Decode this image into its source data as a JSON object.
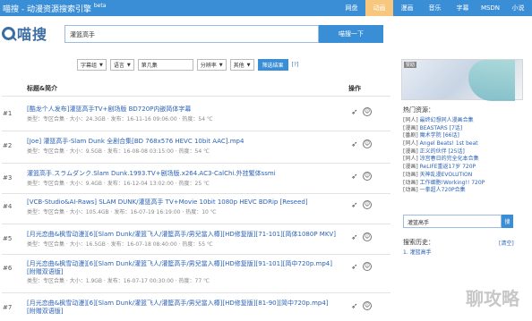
{
  "header": {
    "site_title": "喵搜 - 动漫资源搜索引擎",
    "beta": "beta",
    "nav": [
      "网盘",
      "动画",
      "漫画",
      "音乐",
      "字幕",
      "MSDN",
      "小说"
    ],
    "active_nav": "动画"
  },
  "logo": {
    "text": "喵搜"
  },
  "search": {
    "value": "灌篮高手",
    "button": "喵搜一下"
  },
  "filters": {
    "items": [
      "字幕组",
      "语言",
      "第几集",
      "分辨率",
      "其他"
    ],
    "button": "筛选结果",
    "help": "[?]"
  },
  "table": {
    "col_title": "标题&简介",
    "col_action": "操作"
  },
  "results": [
    {
      "num": "#1",
      "title": "[酷龙个人发布]灌篮高手TV+剧场版 BD720P内嵌简体字幕",
      "meta": "类型：专区合集 · 大小：24.3GB · 发布：16-11-16 09:06:00 · 热度：54 ℃"
    },
    {
      "num": "#2",
      "title": "[Joe] 灌篮高手-Slam Dunk 全剧合集[BD 768x576 HEVC 10bit AAC].mp4",
      "meta": "类型：专区合集 · 大小：9.5GB · 发布：16-08-08 03:15:00 · 热度：54 ℃"
    },
    {
      "num": "#3",
      "title": "灌篮高手.スラムダンク.Slam Dunk.1993.TV+剧场版.x264.AC3-CalChi.外挂繁体ssmi",
      "meta": "类型：专区合集 · 大小：9.4GB · 发布：16-12-04 13:02:00 · 热度：25 ℃"
    },
    {
      "num": "#4",
      "title": "[VCB-Studio&AI-Raws] SLAM DUNK/灌篮高手 TV+Movie 10bit 1080p HEVC BDRip [Reseed]",
      "meta": "类型：专区合集 · 大小：105.4GB · 发布：16-07-19 16:19:00 · 热度：10 ℃"
    },
    {
      "num": "#5",
      "title": "[月光恋曲&枫雪动漫][6][Slam Dunk/灌篮飞人/灌籃高手/男兒當入樽][HD修复版][71-101][简体1080P MKV]",
      "meta": "类型：专区合集 · 大小：16.5GB · 发布：16-07-18 08:40:00 · 热度：55 ℃"
    },
    {
      "num": "#6",
      "title": "[月光恋曲&枫雪动漫][6][Slam Dunk/灌篮飞人/灌籃高手/男兒當入樽][HD修复版][91-101][简中720p.mp4]",
      "title2": "[附赠双语版]",
      "meta": "类型：专区合集 · 大小：1.9GB · 发布：16-07-17 00:30:00 · 热度：77 ℃"
    },
    {
      "num": "#7",
      "title": "[月光恋曲&枫雪动漫][6][Slam Dunk/灌篮飞人/灌籃高手/男兒當入樽][HD修复版][81-90][简中720p.mp4]",
      "title2": "[附赠双语版]",
      "meta": ""
    }
  ],
  "sidebar": {
    "banner_tag": "赞助",
    "hot_title": "热门资源：",
    "hot_items": [
      {
        "cat": "[同人]",
        "text": "最终幻想同人漫画合集"
      },
      {
        "cat": "[漫画]",
        "text": "BEASTARS [7话]"
      },
      {
        "cat": "[番剧]",
        "text": "魔术学院 [66话]"
      },
      {
        "cat": "[同人]",
        "text": "Angel Beats! 1st beat"
      },
      {
        "cat": "[漫画]",
        "text": "正义的伙伴 [25话]"
      },
      {
        "cat": "[同人]",
        "text": "凉宫春日的完全化本合集"
      },
      {
        "cat": "[漫画]",
        "text": "ReLIFE重返17岁 720P"
      },
      {
        "cat": "[动画]",
        "text": "天神乱漫EVOLUTION"
      },
      {
        "cat": "[动画]",
        "text": "工作细胞!Working!! 720P"
      },
      {
        "cat": "[动画]",
        "text": "一拳超人720P合集"
      }
    ],
    "search_value": "灌篮高手",
    "search_btn": "搜",
    "history_title": "搜索历史：",
    "history_clear": "[清空]",
    "history_items": [
      "1. 灌篮高手"
    ]
  },
  "watermark": "聊攻略"
}
